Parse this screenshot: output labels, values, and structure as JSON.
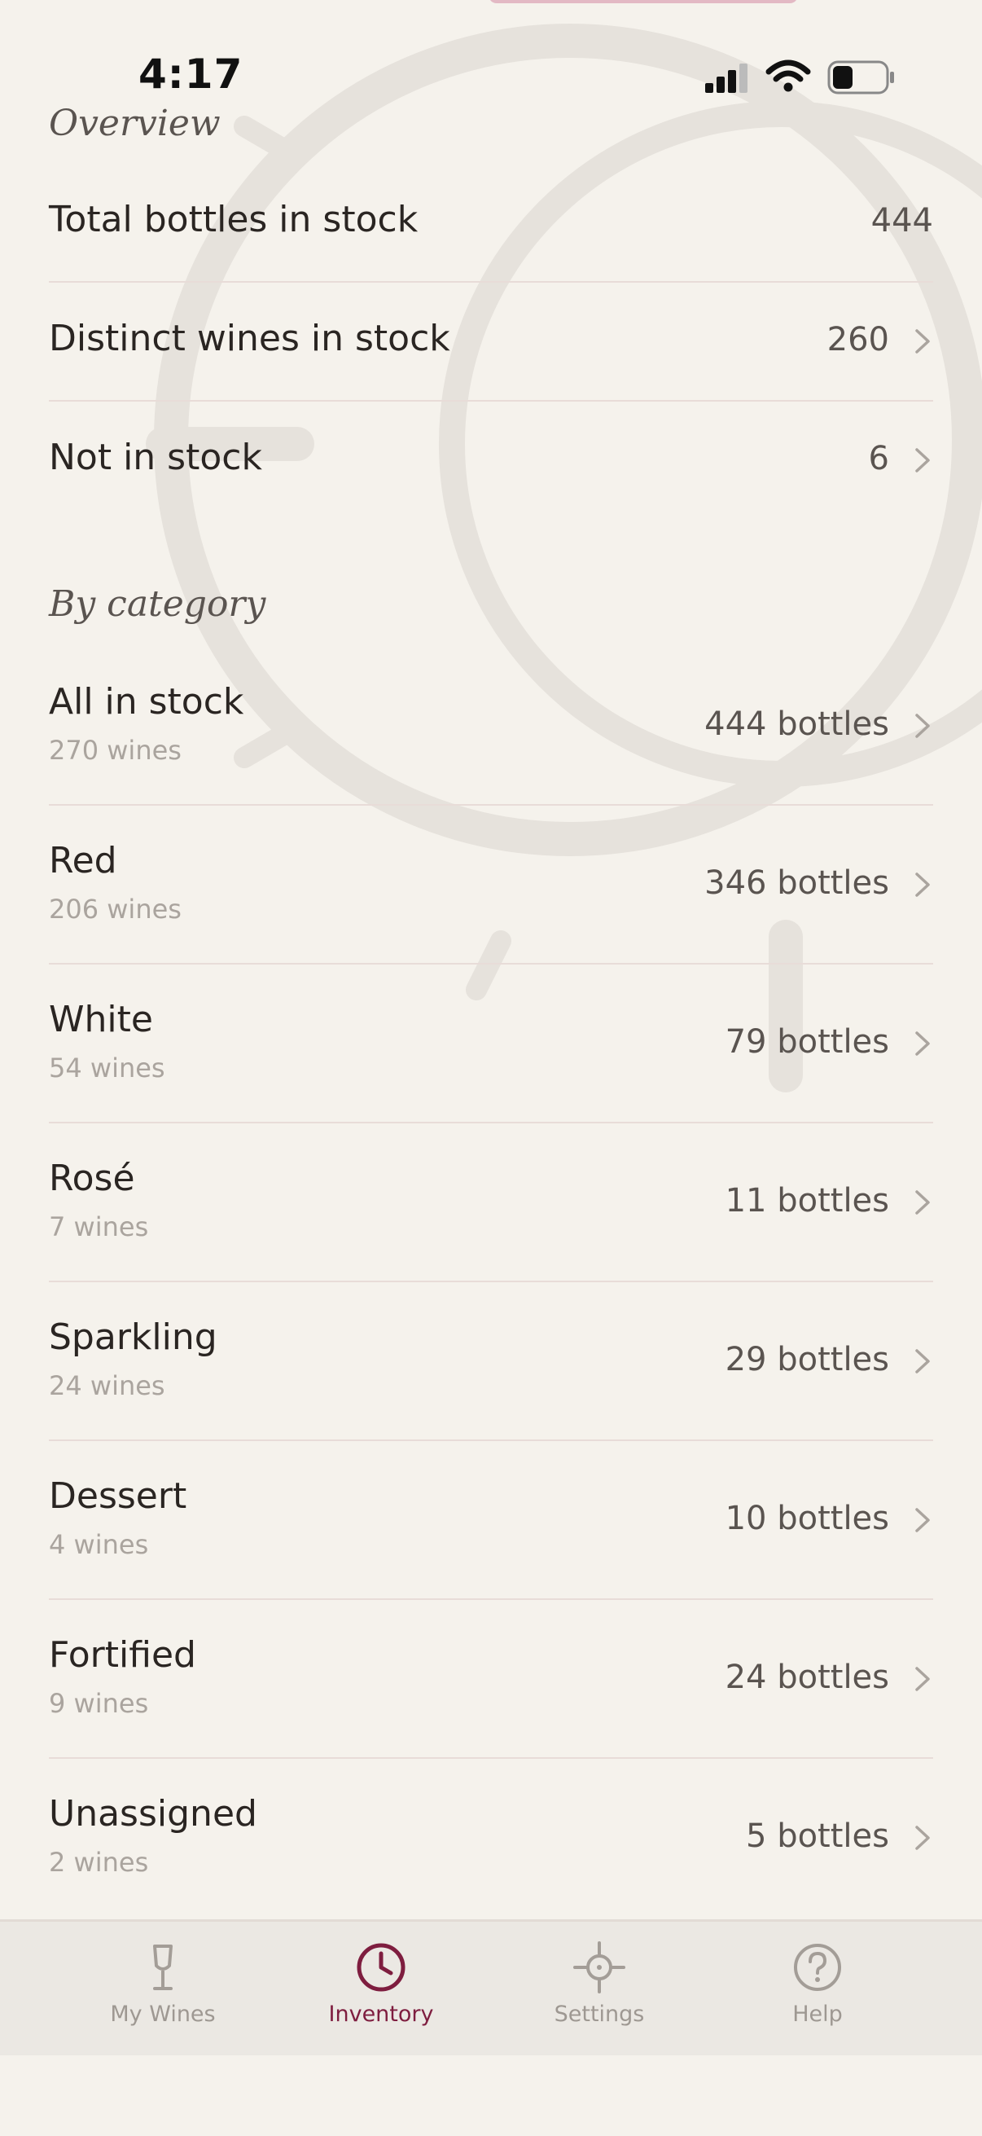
{
  "status_bar": {
    "time": "4:17"
  },
  "overview": {
    "title": "Overview",
    "rows": [
      {
        "label": "Total bottles in stock",
        "value": "444"
      },
      {
        "label": "Distinct wines in stock",
        "value": "260"
      },
      {
        "label": "Not in stock",
        "value": "6"
      }
    ]
  },
  "by_category": {
    "title": "By category",
    "rows": [
      {
        "label": "All in stock",
        "sub": "270 wines",
        "value": "444 bottles"
      },
      {
        "label": "Red",
        "sub": "206 wines",
        "value": "346 bottles"
      },
      {
        "label": "White",
        "sub": "54 wines",
        "value": "79 bottles"
      },
      {
        "label": "Rosé",
        "sub": "7 wines",
        "value": "11 bottles"
      },
      {
        "label": "Sparkling",
        "sub": "24 wines",
        "value": "29 bottles"
      },
      {
        "label": "Dessert",
        "sub": "4 wines",
        "value": "10 bottles"
      },
      {
        "label": "Fortified",
        "sub": "9 wines",
        "value": "24 bottles"
      },
      {
        "label": "Unassigned",
        "sub": "2 wines",
        "value": "5 bottles"
      }
    ]
  },
  "tabbar": {
    "tabs": [
      {
        "label": "My Wines",
        "icon": "wine-glass-icon"
      },
      {
        "label": "Inventory",
        "icon": "clock-icon",
        "active": true
      },
      {
        "label": "Settings",
        "icon": "crosshair-icon"
      },
      {
        "label": "Help",
        "icon": "question-icon"
      }
    ]
  },
  "colors": {
    "accent": "#7e1d3f",
    "background": "#f5f2ec",
    "divider": "#e8dcd8"
  }
}
